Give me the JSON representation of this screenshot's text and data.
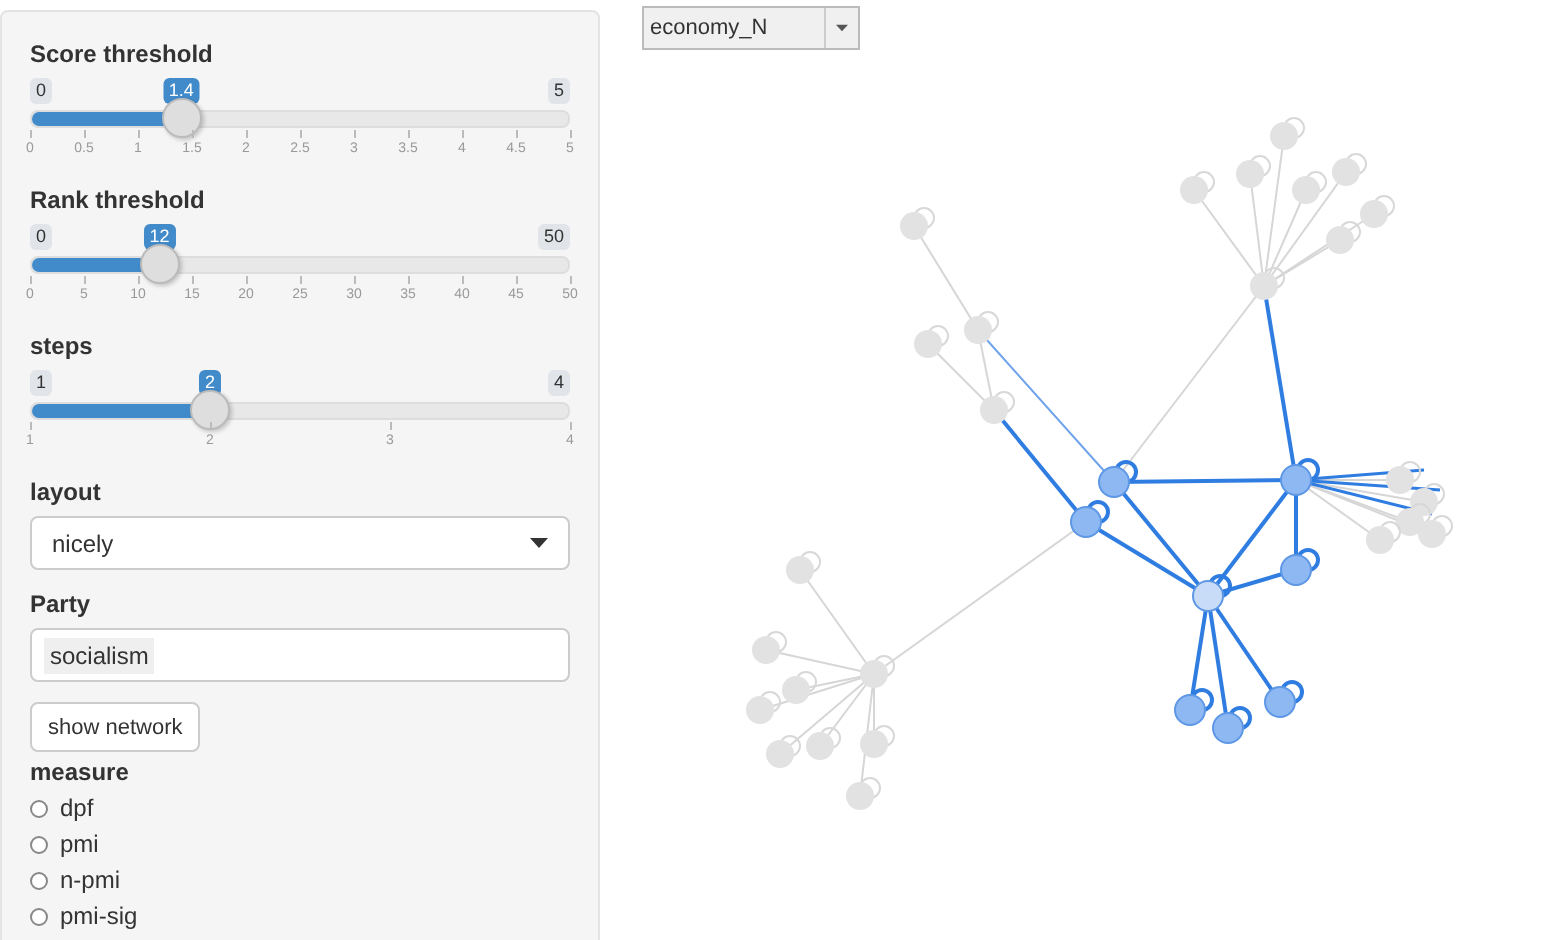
{
  "sliders": [
    {
      "label": "Score threshold",
      "min": "0",
      "max": "5",
      "value": "1.4",
      "level": 0.28,
      "ticks": [
        "0",
        "0.5",
        "1",
        "1.5",
        "2",
        "2.5",
        "3",
        "3.5",
        "4",
        "4.5",
        "5"
      ]
    },
    {
      "label": "Rank threshold",
      "min": "0",
      "max": "50",
      "value": "12",
      "level": 0.24,
      "ticks": [
        "0",
        "5",
        "10",
        "15",
        "20",
        "25",
        "30",
        "35",
        "40",
        "45",
        "50"
      ]
    },
    {
      "label": "steps",
      "min": "1",
      "max": "4",
      "value": "2",
      "level": 0.3333,
      "ticks": [
        "1",
        "2",
        "3",
        "4"
      ]
    }
  ],
  "layout": {
    "label": "layout",
    "value": "nicely"
  },
  "party": {
    "label": "Party",
    "tokens": [
      "socialism"
    ]
  },
  "show_button": "show network",
  "measure": {
    "label": "measure",
    "options": [
      {
        "label": "dpf",
        "selected": false
      },
      {
        "label": "pmi",
        "selected": false
      },
      {
        "label": "n-pmi",
        "selected": false
      },
      {
        "label": "pmi-sig",
        "selected": false
      }
    ]
  },
  "node_select": {
    "value": "economy_N"
  }
}
